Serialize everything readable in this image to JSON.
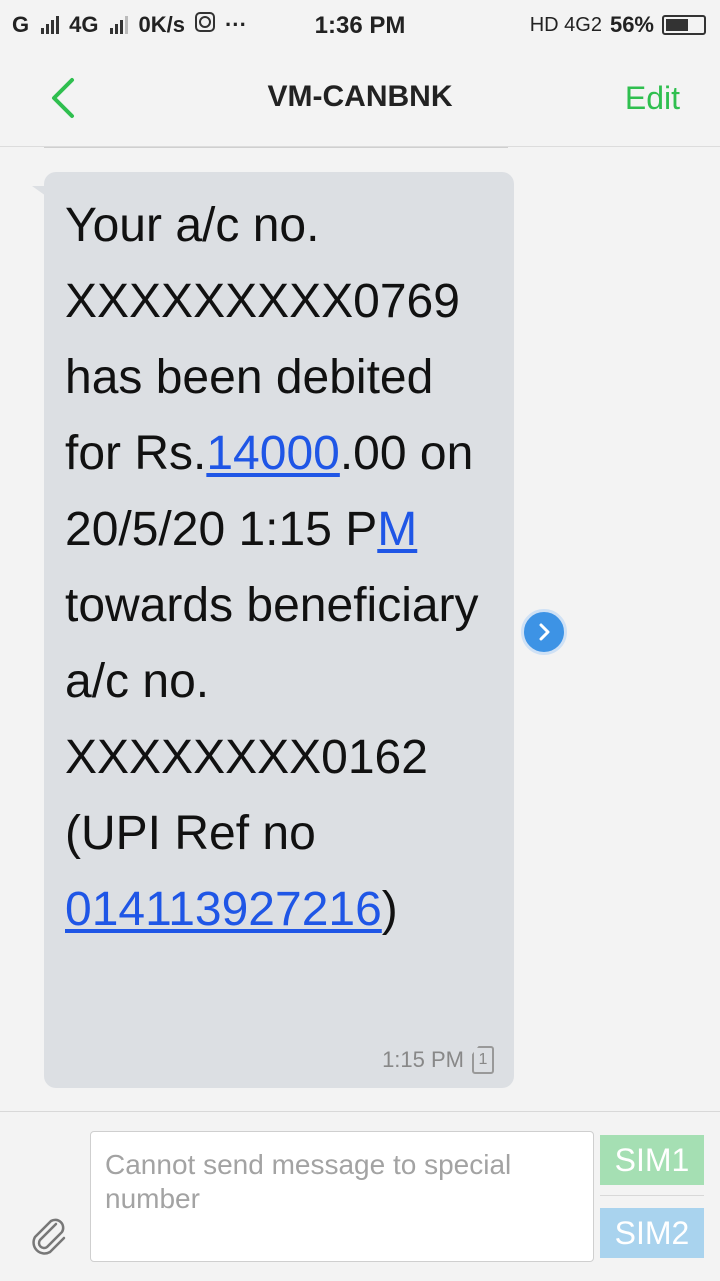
{
  "status_bar": {
    "carrier1": "G",
    "carrier2": "4G",
    "data_speed": "0K/s",
    "more": "···",
    "time": "1:36 PM",
    "hd_network": "HD 4G2",
    "battery": "56%",
    "battery_level_percent": 56
  },
  "header": {
    "title": "VM-CANBNK",
    "edit_label": "Edit"
  },
  "message": {
    "part1": "Your a/c no. XXXXXXXXX0769 has been debited for Rs.",
    "amount_link": "14000",
    "part2": ".00 on 20/5/20 1:15 P",
    "m_link": "M",
    "part3": " towards beneficiary  a/c no. XXXXXXXX0162 (UPI Ref no ",
    "ref_link": "014113927216",
    "part4": ")",
    "time": "1:15 PM",
    "sim_number": "1"
  },
  "composer": {
    "placeholder": "Cannot send message to special number",
    "sim1_label": "SIM1",
    "sim2_label": "SIM2"
  },
  "colors": {
    "accent_green": "#2fbf4f",
    "link_blue": "#1f56e6",
    "bubble": "#dcdfe3",
    "sim1": "#a5dfb3",
    "sim2": "#a9d3ee"
  }
}
